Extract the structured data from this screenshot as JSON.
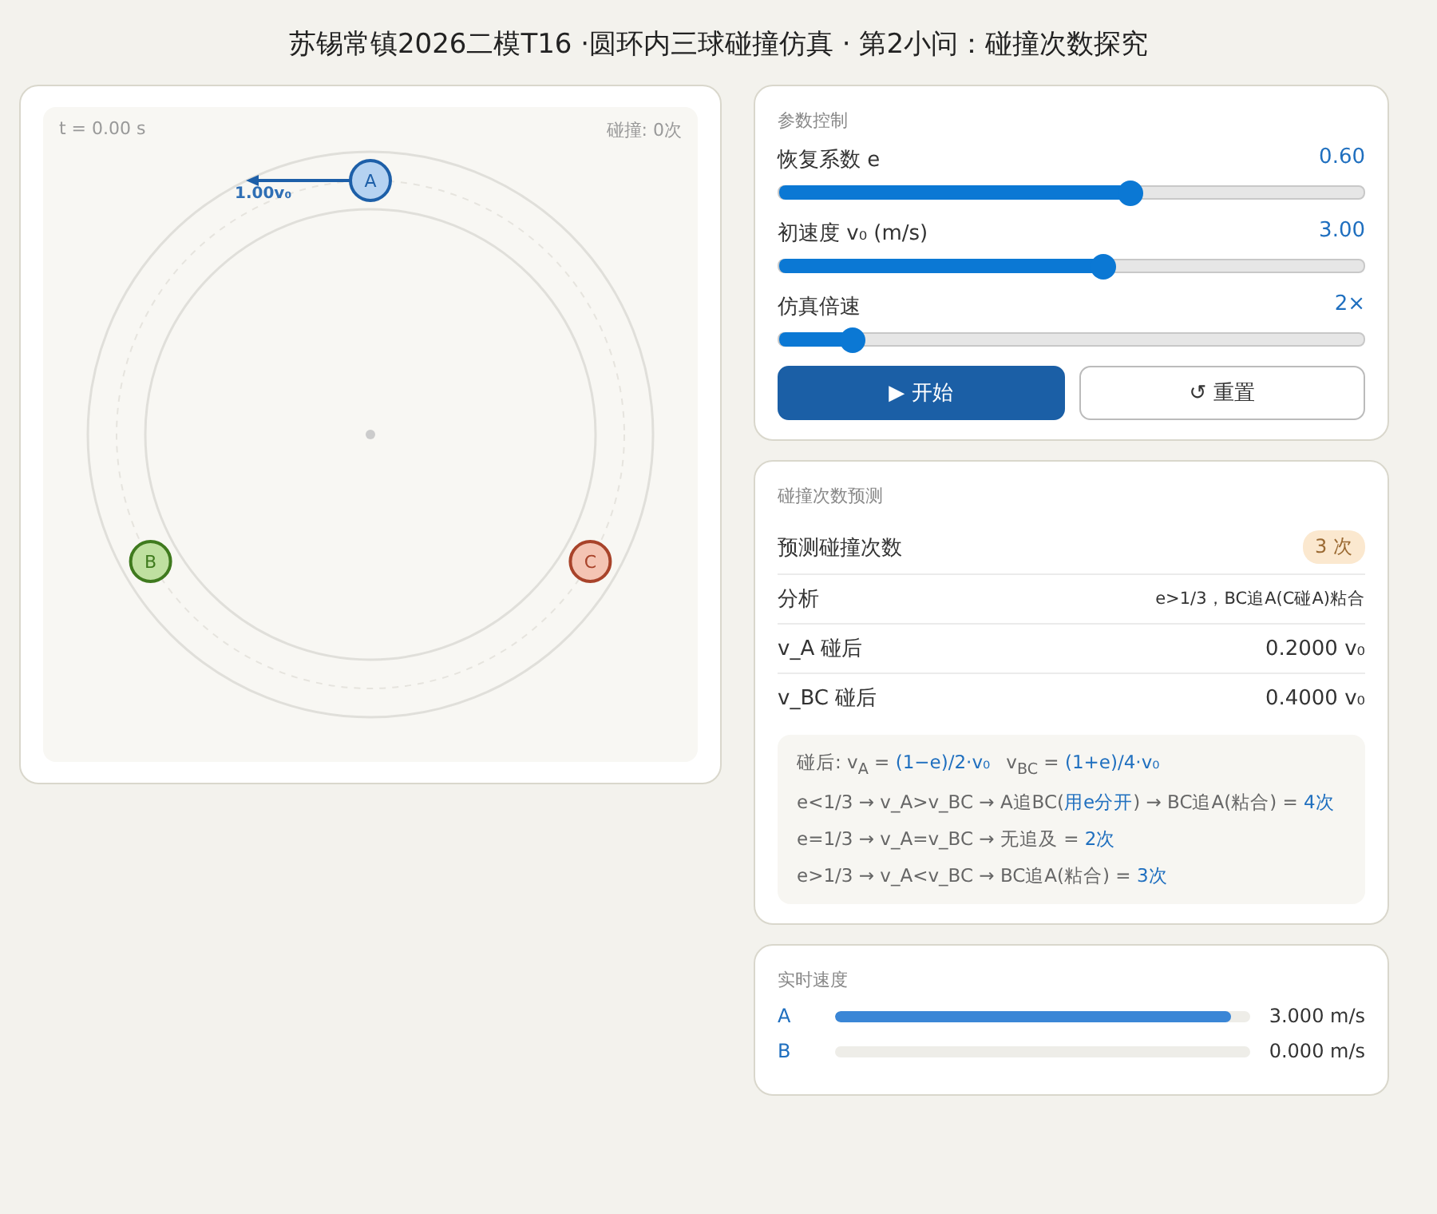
{
  "title": "苏锡常镇2026二模T16 ·圆环内三球碰撞仿真 · 第2小问：碰撞次数探究",
  "simulation": {
    "time": "t = 0.00 s",
    "collisions": "碰撞: 0次",
    "arrow_label": "1.00v₀",
    "balls": [
      {
        "label": "A",
        "color": "#1d5fa8",
        "moving": true
      },
      {
        "label": "B",
        "color": "#3f7a1e",
        "moving": false
      },
      {
        "label": "C",
        "color": "#a8432a",
        "moving": false
      }
    ]
  },
  "controls": {
    "heading": "参数控制",
    "sliders": [
      {
        "label": "恢复系数 e",
        "reading": "0.60",
        "level": 0.6
      },
      {
        "label": "初速度 v₀ (m/s)",
        "reading": "3.00",
        "level": 0.555
      },
      {
        "label": "仿真倍速",
        "reading": "2×",
        "level": 0.125
      }
    ],
    "buttons": [
      {
        "kind": "primary",
        "icon": "▶",
        "label": "开始"
      },
      {
        "kind": "secondary",
        "icon": "↺",
        "label": "重置"
      }
    ]
  },
  "prediction": {
    "heading": "碰撞次数预测",
    "rows": [
      {
        "kind": "badge",
        "label": "预测碰撞次数",
        "value": "3 次"
      },
      {
        "kind": "small",
        "label": "分析",
        "value": "e>1/3，BC追A(C碰A)粘合"
      },
      {
        "kind": "plain",
        "label": "v_A 碰后",
        "value": "0.2000 v₀"
      },
      {
        "kind": "plain",
        "label": "v_BC 碰后",
        "value": "0.4000 v₀"
      }
    ],
    "notes": [
      [
        {
          "text": "碰后: v$_{A}$ = ",
          "highlight": false
        },
        {
          "text": "(1−e)/2·v₀",
          "highlight": true
        },
        {
          "text": "v$_{BC}$ = ",
          "highlight": false
        },
        {
          "text": "(1+e)/4·v₀",
          "highlight": true
        }
      ],
      [
        {
          "text": "e<1/3 → v_A>v_BC → A追BC(",
          "highlight": false
        },
        {
          "text": "用e分开",
          "highlight": true
        },
        {
          "text": ") → BC追A(粘合) = ",
          "highlight": false
        },
        {
          "text": "4次",
          "highlight": true
        }
      ],
      [
        {
          "text": "e=1/3 → v_A=v_BC → 无追及 = ",
          "highlight": false
        },
        {
          "text": "2次",
          "highlight": true
        }
      ],
      [
        {
          "text": "e>1/3 → v_A<v_BC → BC追A(粘合) = ",
          "highlight": false
        },
        {
          "text": "3次",
          "highlight": true
        }
      ]
    ]
  },
  "speeds": {
    "heading": "实时速度",
    "rows": [
      {
        "label": "A",
        "level": 0.955,
        "reading": "3.000 m/s"
      },
      {
        "label": "B",
        "level": 0,
        "reading": "0.000 m/s"
      }
    ]
  }
}
